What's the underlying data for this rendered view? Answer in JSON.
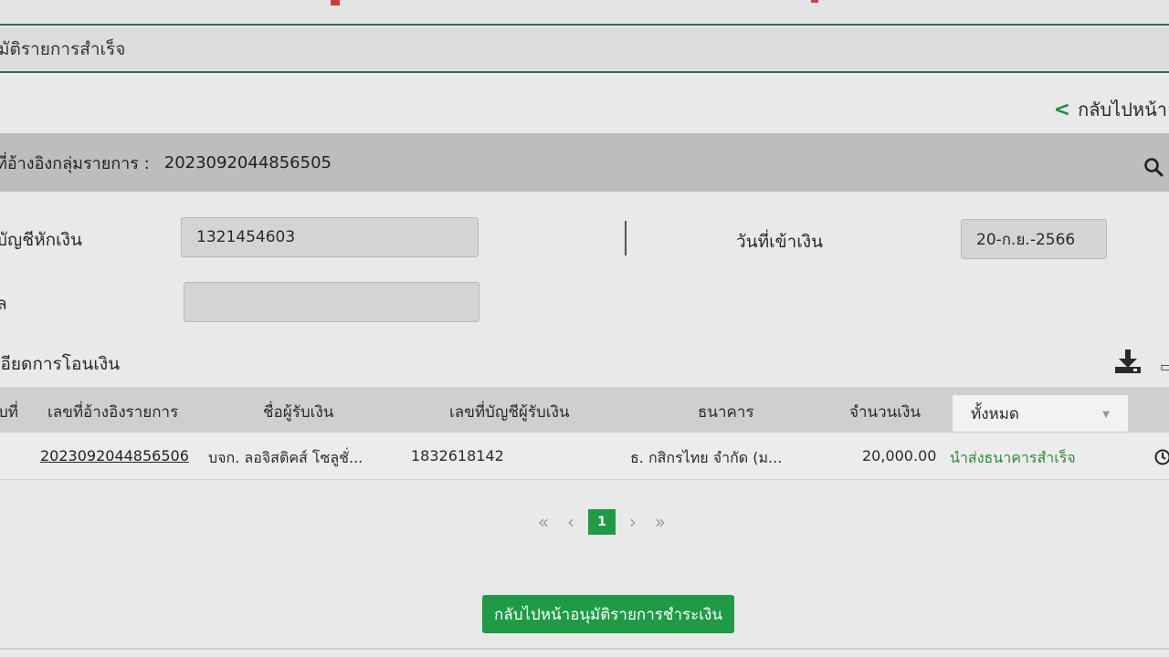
{
  "page": {
    "title": "มัติรายการสำเร็จ",
    "back_link": "กลับไปหน้าอ"
  },
  "group": {
    "label": "ที่อ้างอิงกลุ่มรายการ :",
    "value": "2023092044856505"
  },
  "form": {
    "debit_account_label": "บัญชีหักเงิน",
    "debit_account_value": "1321454603",
    "deposit_date_label": "วันที่เข้าเงิน",
    "deposit_date_value": "20-ก.ย.-2566",
    "remark_label": "ล",
    "remark_value": ""
  },
  "transfer_section": {
    "label": "เอียดการโอนเงิน"
  },
  "table": {
    "headers": {
      "no": "บที่",
      "ref": "เลขที่อ้างอิงรายการ",
      "payee": "ชื่อผู้รับเงิน",
      "account": "เลขที่บัญชีผู้รับเงิน",
      "bank": "ธนาคาร",
      "amount": "จำนวนเงิน"
    },
    "status_filter": "ทั้งหมด",
    "rows": [
      {
        "ref": "2023092044856506",
        "payee": "บจก. ลอจิสติคส์ โซลูชั่...",
        "account": "1832618142",
        "bank": "ธ. กสิกรไทย จำกัด (ม...",
        "amount": "20,000.00",
        "status": "นำส่งธนาคารสำเร็จ"
      }
    ]
  },
  "pagination": {
    "first": "«",
    "prev": "‹",
    "current": "1",
    "next": "›",
    "last": "»"
  },
  "actions": {
    "back_to_approval": "กลับไปหน้าอนุมัติรายการชำระเงิน"
  },
  "colors": {
    "accent_green": "#1f9a46",
    "status_green": "#2f8a3c"
  }
}
